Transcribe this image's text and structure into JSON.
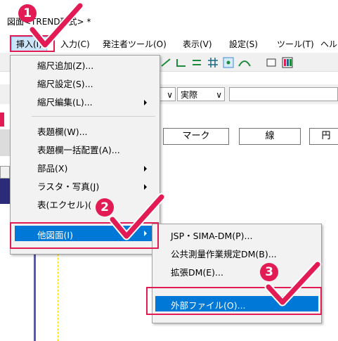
{
  "window": {
    "title": "図面<TREND形式> *"
  },
  "menubar": {
    "items": [
      {
        "label": "挿入(I)",
        "active": true
      },
      {
        "label": "入力(C)"
      },
      {
        "label": "発注者ツール(O)"
      },
      {
        "label": "表示(V)"
      },
      {
        "label": "設定(S)"
      },
      {
        "label": "ツール(T)"
      },
      {
        "label": "ヘル"
      }
    ]
  },
  "toolbar": {
    "combo_left": "",
    "combo_jissai": "実際",
    "combo_right": ""
  },
  "tabs": [
    {
      "label": "マーク"
    },
    {
      "label": "線"
    },
    {
      "label": "円"
    }
  ],
  "insert_menu": {
    "items": [
      {
        "label": "縮尺追加(Z)..."
      },
      {
        "label": "縮尺設定(S)..."
      },
      {
        "label": "縮尺編集(L)...",
        "submenu": true
      },
      {
        "label": "表題欄(W)..."
      },
      {
        "label": "表題欄一括配置(A)..."
      },
      {
        "label": "部品(X)",
        "submenu": true
      },
      {
        "label": "ラスタ・写真(J)",
        "submenu": true
      },
      {
        "label": "表(エクセル)("
      },
      {
        "label": "他図面(I)",
        "submenu": true,
        "highlighted": true
      }
    ]
  },
  "other_menu": {
    "items": [
      {
        "label": "JSP・SIMA-DM(P)..."
      },
      {
        "label": "公共測量作業規定DM(B)..."
      },
      {
        "label": "拡張DM(E)..."
      },
      {
        "label": "外部ファイル(O)...",
        "highlighted": true
      }
    ]
  },
  "steps": [
    "1",
    "2",
    "3"
  ],
  "colors": {
    "accent": "#e31b54",
    "selection": "#0078d7",
    "guide_line": "#ffd700"
  }
}
